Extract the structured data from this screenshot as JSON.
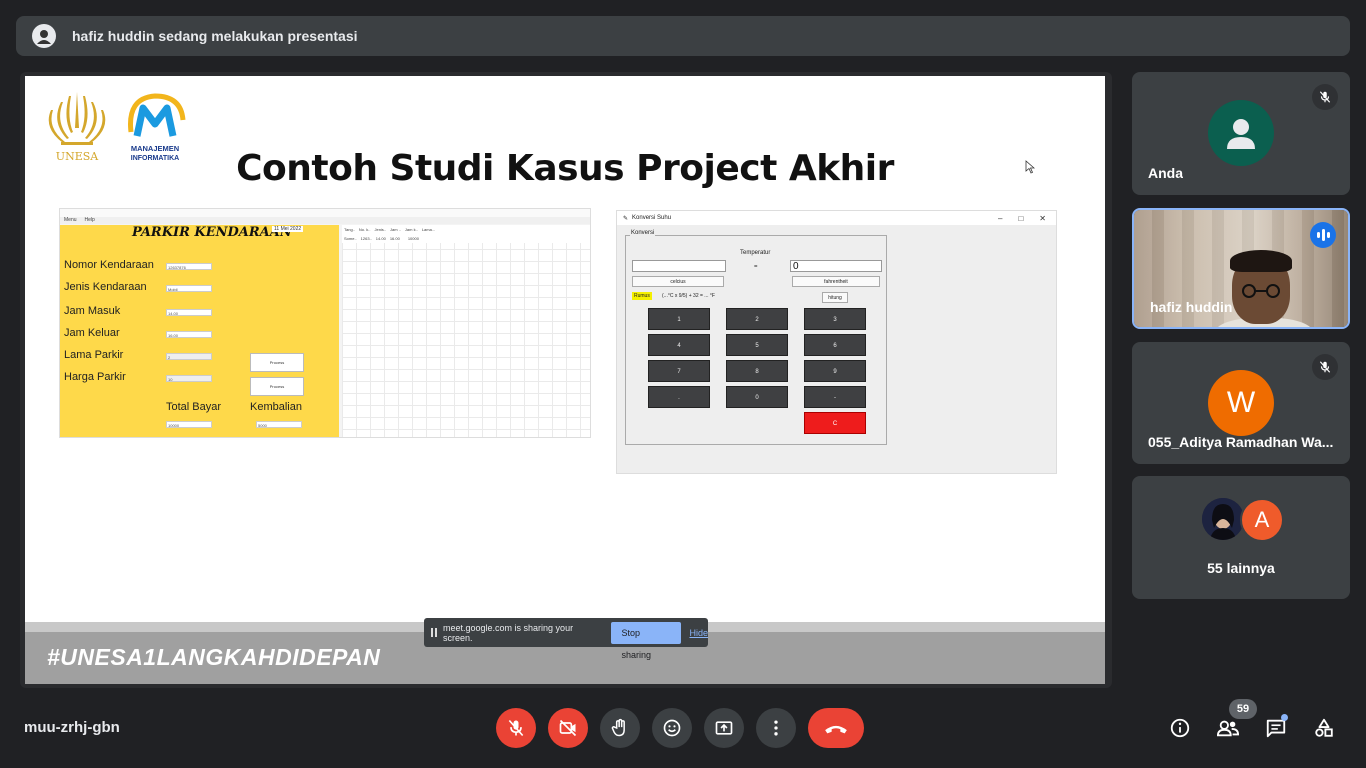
{
  "banner": {
    "text": "hafiz huddin sedang melakukan presentasi"
  },
  "slide": {
    "title": "Contoh Studi Kasus Project Akhir",
    "logo_unesa_text": "UNESA",
    "logo_mi_text1": "MANAJEMEN",
    "logo_mi_text2": "INFORMATIKA",
    "footer": "#UNESA1LANGKAHDIDEPAN",
    "parkir": {
      "menu": [
        "Menu",
        "Help"
      ],
      "heading": "PARKIR KENDARAAN",
      "date": "11 Mei 2022",
      "labels": [
        "Nomor Kendaraan",
        "Jenis Kendaraan",
        "Jam Masuk",
        "Jam Keluar",
        "Lama Parkir",
        "Harga Parkir"
      ],
      "values": [
        "12637876",
        "Mobil",
        "14.00",
        "16.00",
        "2",
        "10"
      ],
      "btn1": "Process",
      "btn2": "Process",
      "total_label": "Total Bayar",
      "kembalian_label": "Kembalian",
      "total_value": "10000",
      "kembalian_value": "5000",
      "grid_headers": [
        "Tang..",
        "No. k..",
        "Jenis..",
        "Jam ..",
        "Jam k..",
        "Lama..."
      ],
      "grid_row": [
        "Some..",
        "1263..",
        "14.00",
        "16.00",
        "",
        "10000"
      ]
    },
    "konversi": {
      "window_title": "Konversi Suhu",
      "group": "Konversi",
      "temperatur": "Temperatur",
      "equals": "=",
      "input_right": "0",
      "combo_left": "celcius",
      "combo_right": "fahrentheit",
      "rumus": "Rumus",
      "formula": "(...°C x 9/5) + 32 = ... °F",
      "hitung": "hitung",
      "keys": [
        "1",
        "2",
        "3",
        "4",
        "5",
        "6",
        "7",
        "8",
        "9",
        ".",
        "0",
        "-",
        "C"
      ]
    }
  },
  "sharebar": {
    "text": "meet.google.com is sharing your screen.",
    "stop": "Stop sharing",
    "hide": "Hide"
  },
  "participants": [
    {
      "name": "Anda"
    },
    {
      "name": "hafiz huddin"
    },
    {
      "name": "055_Aditya Ramadhan Wa...",
      "initial": "W"
    },
    {
      "more": "55 lainnya",
      "initial": "A"
    }
  ],
  "bottom": {
    "meeting_code": "muu-zrhj-gbn",
    "people_count": "59"
  },
  "colors": {
    "end_call": "#ea4335",
    "accent": "#8ab4f8",
    "tile_bg": "#3c4043"
  }
}
